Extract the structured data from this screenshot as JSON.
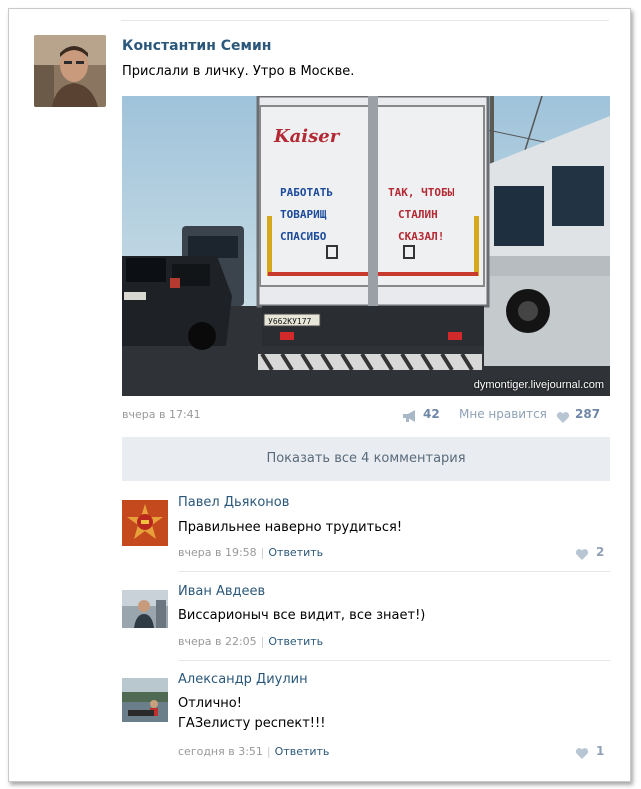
{
  "post": {
    "author": "Константин Семин",
    "text": "Прислали в личку. Утро в Москве.",
    "time": "вчера в 17:41",
    "reposts": "42",
    "like_label": "Мне нравится",
    "likes": "287",
    "watermark": "dymontiger.livejournal.com",
    "photo_texts": {
      "brand": "Kaiser",
      "left_door": [
        "РАБОТАТЬ",
        "ТОВАРИЩ",
        "СПАСИБО"
      ],
      "right_door": [
        "ТАК, ЧТОБЫ",
        "СТАЛИН",
        "СКАЗАЛ!"
      ],
      "plate": "У662КУ177"
    }
  },
  "show_all": "Показать все 4 комментария",
  "comments": [
    {
      "author": "Павел Дьяконов",
      "text": [
        "Правильнее наверно трудиться!"
      ],
      "time": "вчера в 19:58",
      "reply": "Ответить",
      "likes": "2"
    },
    {
      "author": "Иван Авдеев",
      "text": [
        "Виссарионыч все видит, все знает!)"
      ],
      "time": "вчера в 22:05",
      "reply": "Ответить",
      "likes": ""
    },
    {
      "author": "Александр Диулин",
      "text": [
        "Отлично!",
        "ГАЗелисту респект!!!"
      ],
      "time": "сегодня в 3:51",
      "reply": "Ответить",
      "likes": "1"
    }
  ],
  "colors": {
    "link": "#2b587a",
    "like": "#8fa1b5",
    "panel": "#e9edf1"
  }
}
